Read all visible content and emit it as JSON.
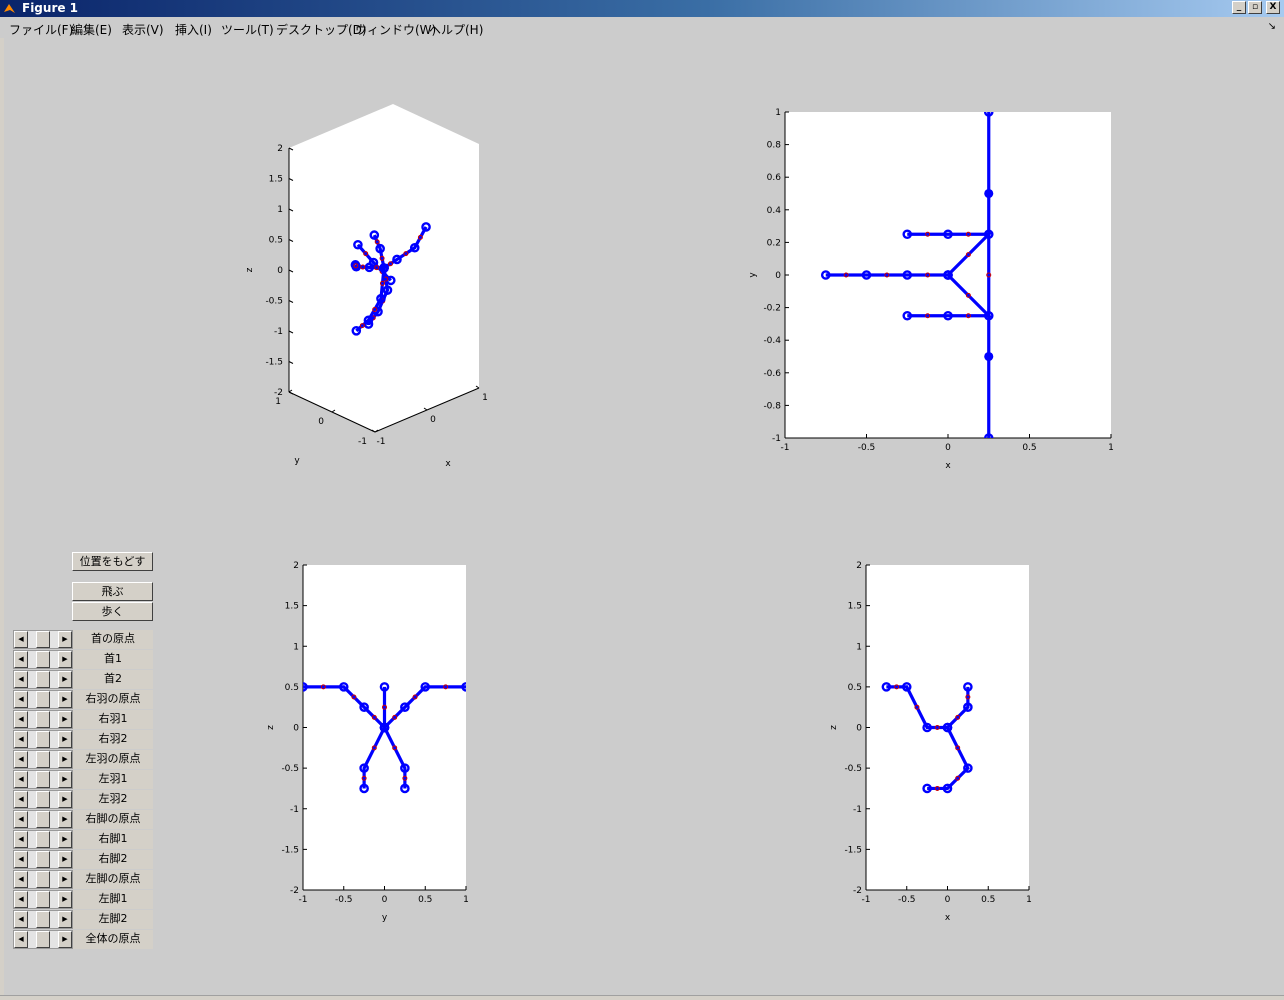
{
  "window": {
    "title": "Figure 1",
    "minimize": "_",
    "restore": "▫",
    "close": "X"
  },
  "menu": [
    "ファイル(F)",
    "編集(E)",
    "表示(V)",
    "挿入(I)",
    "ツール(T)",
    "デスクトップ(D)",
    "ウィンドウ(W)",
    "ヘルプ(H)"
  ],
  "menu_overflow": "↘",
  "buttons": {
    "reset": "位置をもどす",
    "fly": "飛ぶ",
    "walk": "歩く"
  },
  "sliders": [
    "首の原点",
    "首1",
    "首2",
    "右羽の原点",
    "右羽1",
    "右羽2",
    "左羽の原点",
    "左羽1",
    "左羽2",
    "右脚の原点",
    "右脚1",
    "右脚2",
    "左脚の原点",
    "左脚1",
    "左脚2",
    "全体の原点"
  ],
  "slider_arrows": {
    "left": "◀",
    "right": "▶"
  },
  "colors": {
    "line": "#0000ff",
    "marker": "#0000ff",
    "joint": "#cc0000"
  },
  "chart_data": [
    {
      "type": "line",
      "projection": "3d",
      "xlabel": "x",
      "ylabel": "y",
      "zlabel": "z",
      "xlim": [
        -1,
        1
      ],
      "ylim": [
        -1,
        1
      ],
      "zlim": [
        -2,
        2
      ],
      "xticks": [
        "-1",
        "0",
        "1"
      ],
      "yticks": [
        "-1",
        "0",
        "1"
      ],
      "zticks": [
        "-2",
        "-1.5",
        "-1",
        "-0.5",
        "0",
        "0.5",
        "1",
        "1.5",
        "2"
      ],
      "series": [
        {
          "points": [
            [
              -0.2,
              -0.4,
              0
            ],
            [
              -0.45,
              -0.3,
              0.35
            ],
            [
              -0.75,
              -0.3,
              0.75
            ]
          ]
        },
        {
          "points": [
            [
              0,
              0,
              0
            ],
            [
              0.05,
              0.15,
              0.25
            ],
            [
              0.02,
              0.25,
              0.45
            ]
          ]
        },
        {
          "points": [
            [
              0,
              0,
              0
            ],
            [
              0.25,
              0,
              0.05
            ],
            [
              0.55,
              -0.05,
              0.15
            ],
            [
              0.85,
              0.05,
              0.35
            ]
          ]
        },
        {
          "points": [
            [
              0,
              0,
              0
            ],
            [
              -0.2,
              0.1,
              0.05
            ],
            [
              -0.45,
              0.1,
              0.15
            ],
            [
              -0.55,
              0,
              0.25
            ]
          ]
        },
        {
          "points": [
            [
              0,
              0,
              0
            ],
            [
              0.15,
              0.1,
              -0.45
            ],
            [
              0.05,
              0.2,
              -0.8
            ],
            [
              -0.05,
              0.3,
              -1.0
            ]
          ]
        },
        {
          "points": [
            [
              0,
              0,
              0
            ],
            [
              -0.1,
              -0.05,
              -0.45
            ],
            [
              -0.3,
              0,
              -0.75
            ],
            [
              -0.45,
              0.1,
              -0.9
            ]
          ]
        }
      ]
    },
    {
      "type": "line",
      "view": "top",
      "xlabel": "x",
      "ylabel": "y",
      "xlim": [
        -1,
        1
      ],
      "ylim": [
        -1,
        1
      ],
      "xticks": [
        "-1",
        "-0.5",
        "0",
        "0.5",
        "1"
      ],
      "yticks": [
        "-1",
        "-0.8",
        "-0.6",
        "-0.4",
        "-0.2",
        "0",
        "0.2",
        "0.4",
        "0.6",
        "0.8",
        "1"
      ],
      "series": [
        {
          "points": [
            [
              0.25,
              -1
            ],
            [
              0.25,
              1
            ]
          ]
        },
        {
          "points": [
            [
              0,
              0
            ],
            [
              -0.25,
              0
            ],
            [
              -0.5,
              0
            ],
            [
              -0.75,
              0
            ]
          ]
        },
        {
          "points": [
            [
              0,
              0
            ],
            [
              0.25,
              0.25
            ],
            [
              0,
              0.25
            ],
            [
              -0.25,
              0.25
            ]
          ]
        },
        {
          "points": [
            [
              0,
              0
            ],
            [
              0.25,
              -0.25
            ],
            [
              0,
              -0.25
            ],
            [
              -0.25,
              -0.25
            ]
          ]
        },
        {
          "markers": [
            [
              0.25,
              0.5
            ],
            [
              0.25,
              -0.5
            ]
          ]
        }
      ]
    },
    {
      "type": "line",
      "view": "front",
      "xlabel": "y",
      "ylabel": "z",
      "xlim": [
        -1,
        1
      ],
      "ylim": [
        -2,
        2
      ],
      "xticks": [
        "-1",
        "-0.5",
        "0",
        "0.5",
        "1"
      ],
      "yticks": [
        "-2",
        "-1.5",
        "-1",
        "-0.5",
        "0",
        "0.5",
        "1",
        "1.5",
        "2"
      ],
      "series": [
        {
          "points": [
            [
              -1,
              0.5
            ],
            [
              -0.5,
              0.5
            ],
            [
              -0.25,
              0.25
            ],
            [
              0,
              0
            ],
            [
              0.25,
              0.25
            ],
            [
              0.5,
              0.5
            ],
            [
              1,
              0.5
            ]
          ]
        },
        {
          "points": [
            [
              0,
              0
            ],
            [
              0,
              0.5
            ]
          ]
        },
        {
          "points": [
            [
              0,
              0
            ],
            [
              -0.25,
              -0.5
            ],
            [
              -0.25,
              -0.75
            ]
          ]
        },
        {
          "points": [
            [
              0,
              0
            ],
            [
              0.25,
              -0.5
            ],
            [
              0.25,
              -0.75
            ]
          ]
        }
      ]
    },
    {
      "type": "line",
      "view": "side",
      "xlabel": "x",
      "ylabel": "z",
      "xlim": [
        -1,
        1
      ],
      "ylim": [
        -2,
        2
      ],
      "xticks": [
        "-1",
        "-0.5",
        "0",
        "0.5",
        "1"
      ],
      "yticks": [
        "-2",
        "-1.5",
        "-1",
        "-0.5",
        "0",
        "0.5",
        "1",
        "1.5",
        "2"
      ],
      "series": [
        {
          "points": [
            [
              -0.75,
              0.5
            ],
            [
              -0.5,
              0.5
            ],
            [
              -0.25,
              0
            ],
            [
              0,
              0
            ],
            [
              0.25,
              0.25
            ],
            [
              0.25,
              0.5
            ]
          ]
        },
        {
          "points": [
            [
              0,
              0
            ],
            [
              0.25,
              -0.5
            ],
            [
              0,
              -0.75
            ],
            [
              -0.25,
              -0.75
            ]
          ]
        }
      ]
    }
  ]
}
